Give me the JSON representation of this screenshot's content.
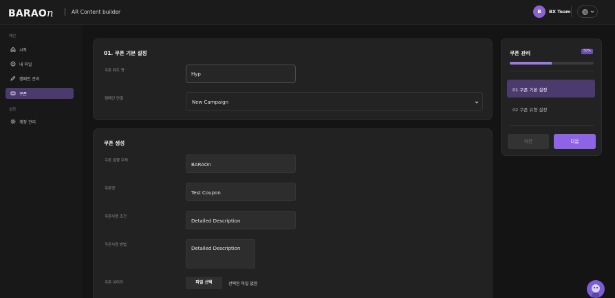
{
  "header": {
    "logo_main": "BARAO",
    "logo_suffix": "n",
    "app_name": "AR Content builder",
    "avatar_initial": "B",
    "team_name": "BX Team"
  },
  "sidebar": {
    "section_main": "메인",
    "items": [
      {
        "label": "시작",
        "icon": "home-icon"
      },
      {
        "label": "내 파일",
        "icon": "file-icon"
      },
      {
        "label": "캠페인 관리",
        "icon": "edit-icon"
      },
      {
        "label": "쿠폰",
        "icon": "coupon-icon",
        "active": true
      }
    ],
    "section_settings": "설정",
    "settings_items": [
      {
        "label": "계정 관리",
        "icon": "gear-icon"
      }
    ]
  },
  "basic": {
    "title": "01. 쿠폰 기본 설정",
    "coupon_name_label": "쿠폰 뮤트 명",
    "coupon_name_value": "Hyp",
    "campaign_label": "캠페인 연결",
    "campaign_value": "New Campaign"
  },
  "create": {
    "title": "쿠폰 생성",
    "issuer_label": "쿠폰 발행 주체",
    "issuer_value": "BARAOn",
    "name_label": "쿠폰명",
    "name_value": "Test Coupon",
    "condition_label": "쿠폰사용 조건",
    "condition_value": "Detailed Description",
    "method_label": "쿠폰사용 방법",
    "method_value": "Detailed Description",
    "image_label": "쿠폰 이미지",
    "file_button": "파일 선택",
    "file_none": "선택된 파일 없음"
  },
  "panel": {
    "title": "쿠폰 관리",
    "progress_label": "50%",
    "progress": 0.5,
    "steps": [
      {
        "label": "01 쿠폰 기본 설정",
        "active": true
      },
      {
        "label": "02 쿠폰 유형 설정",
        "active": false
      }
    ],
    "prev_label": "이전",
    "next_label": "다음"
  },
  "colors": {
    "accent": "#8f63e6",
    "active_bg": "#4b3a6e",
    "bg": "#141414",
    "card": "#222222"
  }
}
